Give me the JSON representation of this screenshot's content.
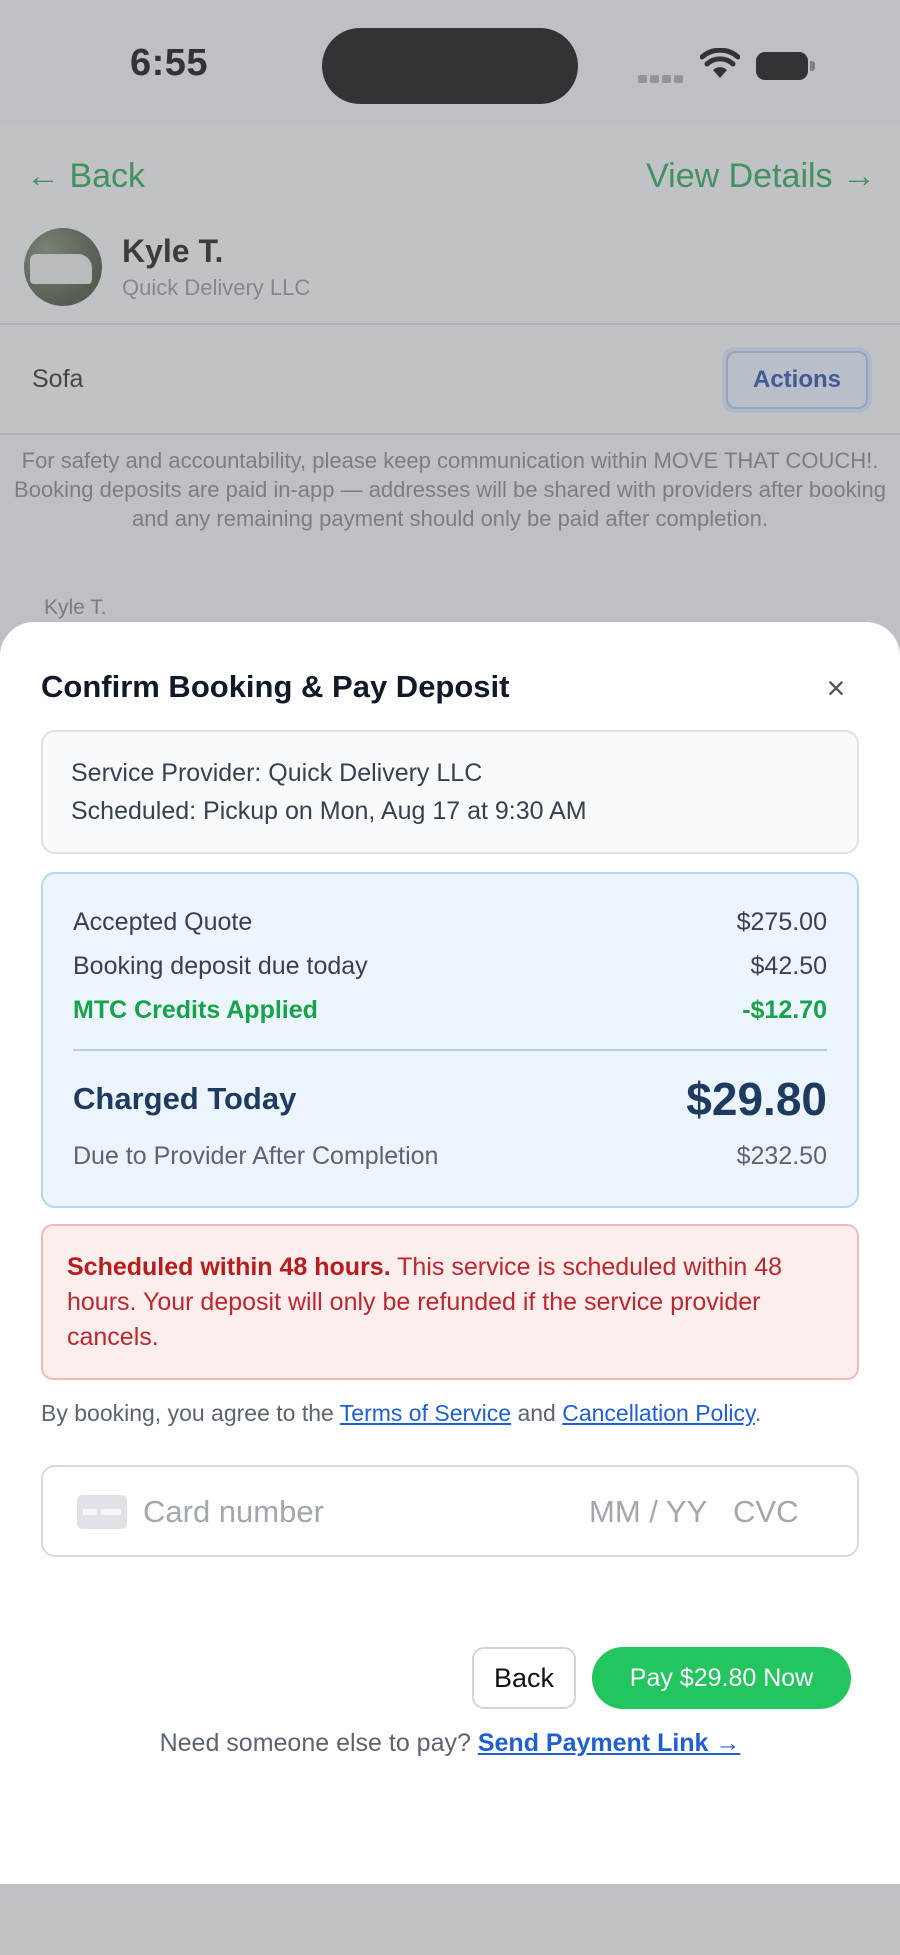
{
  "status_bar": {
    "time": "6:55"
  },
  "nav": {
    "back": "← Back",
    "view_details": "View Details →"
  },
  "provider": {
    "name": "Kyle T.",
    "company": "Quick Delivery LLC"
  },
  "item": {
    "name": "Sofa",
    "actions_label": "Actions"
  },
  "notice": "For safety and accountability, please keep communication within MOVE THAT COUCH!. Booking deposits are paid in-app — addresses will be shared with providers after booking and any remaining payment should only be paid after completion.",
  "chat": {
    "sender": "Kyle T."
  },
  "modal": {
    "title": "Confirm Booking & Pay Deposit",
    "close_icon": "×",
    "info": {
      "provider_line": "Service Provider: Quick Delivery LLC",
      "schedule_line": "Scheduled: Pickup on Mon, Aug 17 at 9:30 AM"
    },
    "quote": {
      "accepted_label": "Accepted Quote",
      "accepted_value": "$275.00",
      "deposit_label": "Booking deposit due today",
      "deposit_value": "$42.50",
      "credits_label": "MTC Credits Applied",
      "credits_value": "-$12.70",
      "charged_label": "Charged Today",
      "charged_value": "$29.80",
      "due_label": "Due to Provider After Completion",
      "due_value": "$232.50"
    },
    "warning": {
      "bold": "Scheduled within 48 hours.",
      "text": " This service is scheduled within 48 hours. Your deposit will only be refunded if the service provider cancels."
    },
    "agreement": {
      "prefix": "By booking, you agree to the ",
      "terms": "Terms of Service",
      "and": " and ",
      "policy": "Cancellation Policy",
      "suffix": "."
    },
    "card": {
      "number_placeholder": "Card number",
      "expiry_placeholder": "MM / YY",
      "cvc_placeholder": "CVC"
    },
    "back_label": "Back",
    "pay_label": "Pay $29.80 Now",
    "pay_link": {
      "prompt": "Need someone else to pay? ",
      "link": "Send Payment Link →"
    }
  },
  "colors": {
    "accent_green": "#22c55e",
    "link_blue": "#1f5fd6",
    "warning_red": "#c0262d",
    "quote_bg": "#ecf5fd"
  }
}
